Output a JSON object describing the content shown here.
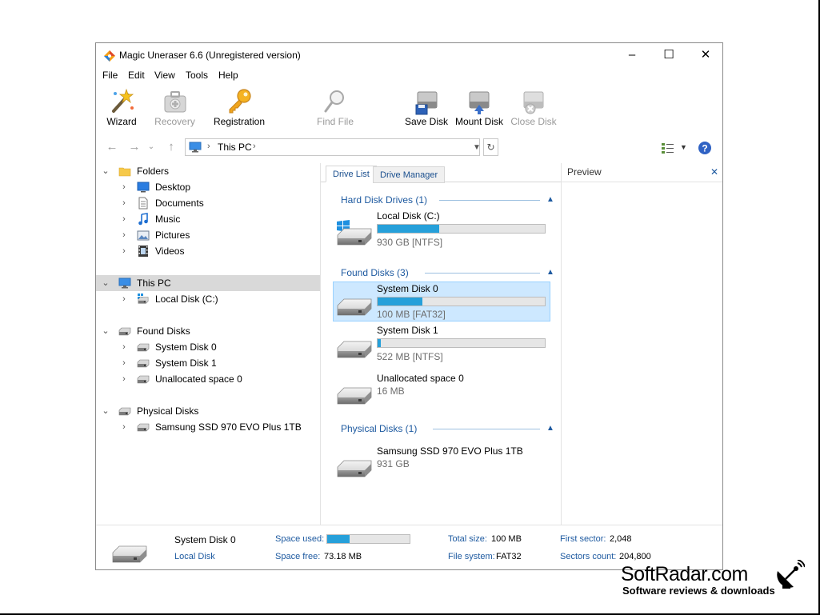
{
  "window": {
    "title": "Magic Uneraser 6.6 (Unregistered version)",
    "controls": {
      "minimize": "–",
      "maximize": "☐",
      "close": "✕"
    }
  },
  "menu": [
    "File",
    "Edit",
    "View",
    "Tools",
    "Help"
  ],
  "toolbar": {
    "wizard": "Wizard",
    "recovery": "Recovery",
    "registration": "Registration",
    "find_file": "Find File",
    "save_disk": "Save Disk",
    "mount_disk": "Mount Disk",
    "close_disk": "Close Disk"
  },
  "address": {
    "path_root": "This PC",
    "separator": "›"
  },
  "tree": {
    "folders": "Folders",
    "folder_items": [
      "Desktop",
      "Documents",
      "Music",
      "Pictures",
      "Videos"
    ],
    "this_pc": "This PC",
    "this_pc_items": [
      "Local Disk (C:)"
    ],
    "found_disks": "Found Disks",
    "found_items": [
      "System Disk 0",
      "System Disk 1",
      "Unallocated space 0"
    ],
    "physical_disks": "Physical Disks",
    "physical_items": [
      "Samsung SSD 970 EVO Plus 1TB"
    ]
  },
  "tabs": {
    "drive_list": "Drive List",
    "drive_manager": "Drive Manager"
  },
  "drive_list": {
    "hard_disk_header": "Hard Disk Drives (1)",
    "found_header": "Found Disks (3)",
    "physical_header": "Physical Disks (1)",
    "local_disk": {
      "name": "Local Disk (C:)",
      "info": "930 GB [NTFS]",
      "used_fraction": 0.37
    },
    "system0": {
      "name": "System Disk 0",
      "info": "100 MB [FAT32]",
      "used_fraction": 0.27
    },
    "system1": {
      "name": "System Disk 1",
      "info": "522 MB [NTFS]",
      "used_fraction": 0.02
    },
    "unalloc": {
      "name": "Unallocated space 0",
      "info": "16 MB"
    },
    "samsung": {
      "name": "Samsung SSD 970 EVO Plus 1TB",
      "info": "931 GB"
    }
  },
  "preview": {
    "title": "Preview",
    "close": "✕"
  },
  "status": {
    "disk_name": "System Disk 0",
    "disk_type": "Local Disk",
    "space_used_label": "Space used:",
    "space_used_fraction": 0.27,
    "space_free_label": "Space free:",
    "space_free_value": "73.18 MB",
    "total_size_label": "Total size:",
    "total_size_value": "100 MB",
    "file_system_label": "File system:",
    "file_system_value": "FAT32",
    "first_sector_label": "First sector:",
    "first_sector_value": "2,048",
    "sectors_count_label": "Sectors count:",
    "sectors_count_value": "204,800"
  },
  "watermark": {
    "brand": "SoftRadar.com",
    "tagline": "Software reviews & downloads"
  },
  "colors": {
    "accent": "#26a0da",
    "link": "#1e5aa0",
    "selection": "#cde8ff"
  }
}
